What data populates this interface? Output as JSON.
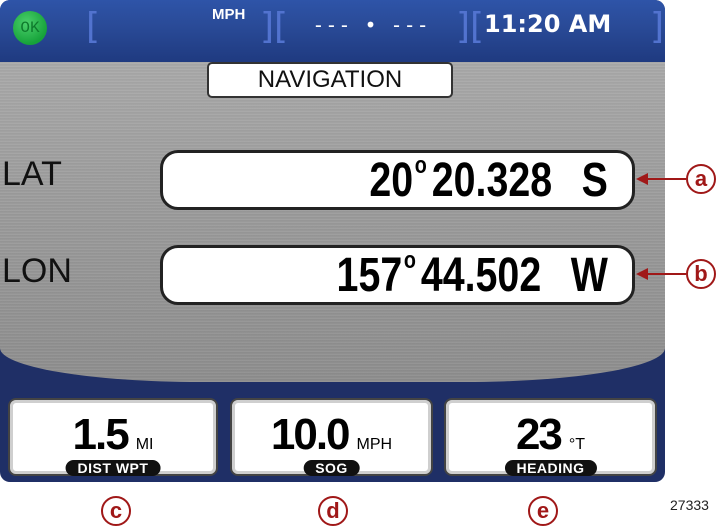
{
  "status_bar": {
    "ok_label": "OK",
    "speed_unit": "MPH",
    "speed_readout": "--- • ---",
    "time": "11:20 AM",
    "colors": {
      "bar": "#2a4b98",
      "ok_indicator": "#16a23a"
    }
  },
  "screen_title": "NAVIGATION",
  "position": {
    "lat": {
      "label": "LAT",
      "degrees": "20",
      "degree_symbol": "o",
      "minutes": "20.328",
      "hemisphere": "S"
    },
    "lon": {
      "label": "LON",
      "degrees": "157",
      "degree_symbol": "o",
      "minutes": "44.502",
      "hemisphere": "W"
    }
  },
  "gauges": [
    {
      "value": "1.5",
      "unit": "MI",
      "label": "DIST WPT"
    },
    {
      "value": "10.0",
      "unit": "MPH",
      "label": "SOG"
    },
    {
      "value": "23",
      "unit": "°T",
      "label": "HEADING"
    }
  ],
  "callouts": {
    "a": "a",
    "b": "b",
    "c": "c",
    "d": "d",
    "e": "e"
  },
  "figure_number": "27333"
}
